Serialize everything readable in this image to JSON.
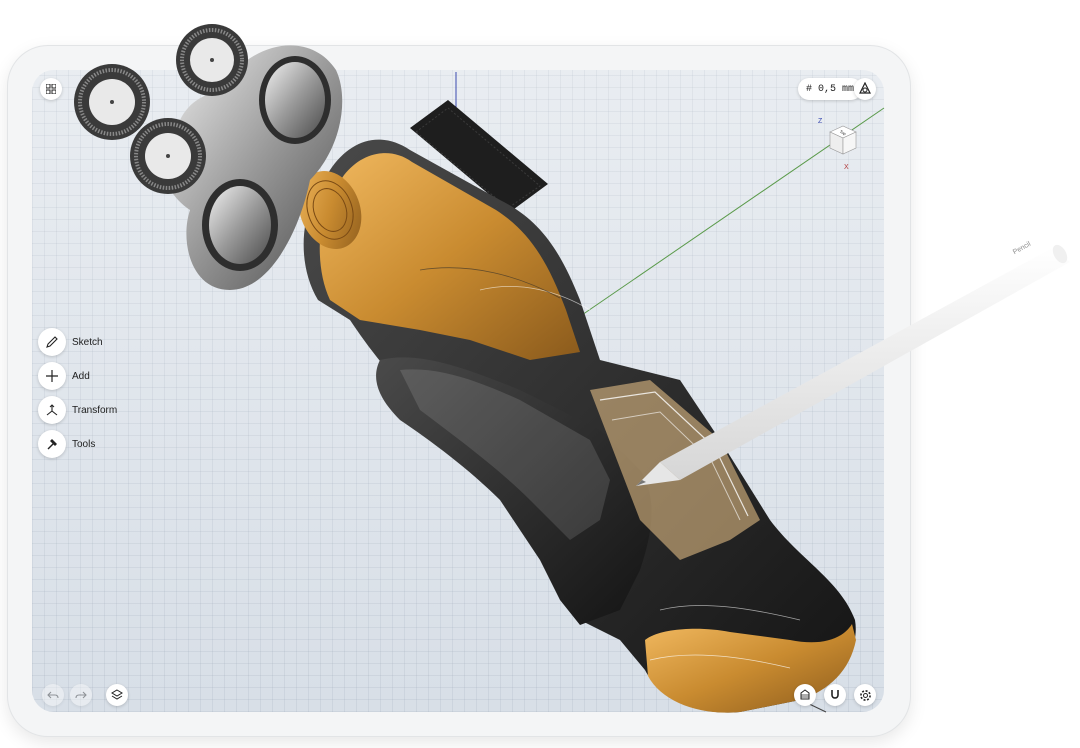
{
  "toolbar_top": {
    "grid_icon": "grid-icon",
    "help_icon": "help-icon",
    "grid_size": "# 0,5 mm",
    "view_icon": "view-mode-icon"
  },
  "view_cube": {
    "axis_z": "Z",
    "axis_x": "X"
  },
  "side_menu": {
    "items": [
      {
        "label": "Sketch",
        "icon": "pen-icon"
      },
      {
        "label": "Add",
        "icon": "plus-icon"
      },
      {
        "label": "Transform",
        "icon": "transform-icon"
      },
      {
        "label": "Tools",
        "icon": "hammer-icon"
      }
    ]
  },
  "toolbar_bottom": {
    "undo_icon": "undo-icon",
    "redo_icon": "redo-icon",
    "layers_icon": "layers-icon",
    "material_icon": "material-icon",
    "snap_icon": "magnet-icon",
    "settings_icon": "settings-icon"
  },
  "pencil": {
    "brand": "Pencil"
  },
  "colors": {
    "accent_gold": "#d89a3c",
    "body_dark": "#2a2a2a",
    "grid_bg": "#dde3ea",
    "axis_green": "#5a9a4a",
    "axis_blue": "#3a4ab0"
  }
}
